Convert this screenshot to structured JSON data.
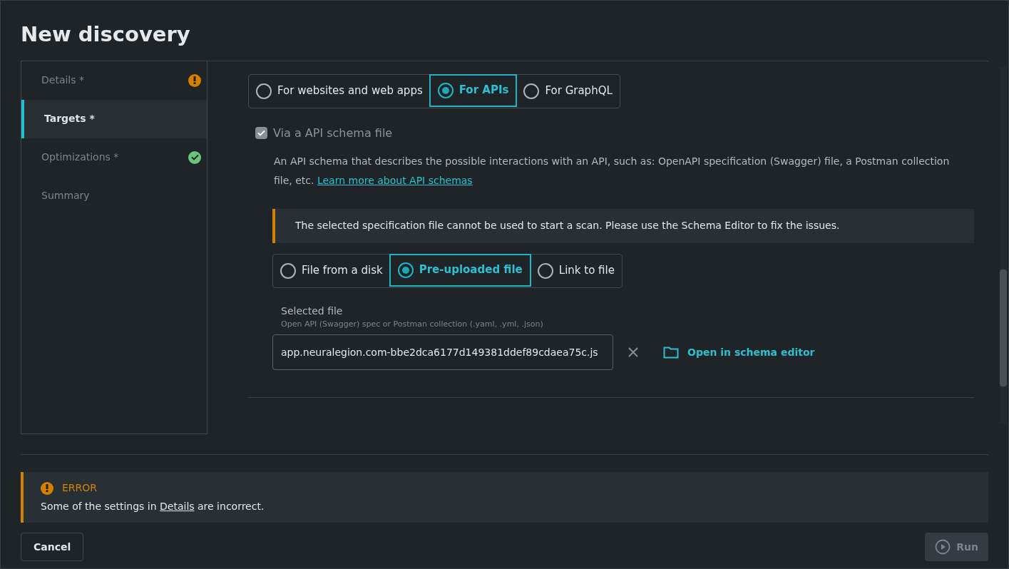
{
  "window": {
    "title": "New discovery"
  },
  "sidebar": {
    "items": [
      {
        "label": "Details *",
        "selected": false,
        "kind": "warning"
      },
      {
        "label": "Targets *",
        "selected": true,
        "kind": "plain"
      },
      {
        "label": "Optimizations *",
        "selected": false,
        "kind": "ok"
      },
      {
        "label": "Summary",
        "selected": false,
        "kind": "plain"
      }
    ]
  },
  "target_type": [
    {
      "label": "For websites and web apps",
      "selected": false
    },
    {
      "label": "For APIs",
      "selected": true
    },
    {
      "label": "For GraphQL",
      "selected": false
    }
  ],
  "schema_option": {
    "label": "Via a API schema file",
    "checked": true,
    "description": "An API schema that describes the possible interactions with an API, such as: OpenAPI specification (Swagger) file, a Postman collection file, etc.",
    "link": "Learn more about API schemas"
  },
  "warning": {
    "text": "The selected specification file cannot be used to start a scan. Please use the Schema Editor to fix the issues."
  },
  "file_source": [
    {
      "label": "File from a disk",
      "selected": false
    },
    {
      "label": "Pre-uploaded file",
      "selected": true
    },
    {
      "label": "Link to file",
      "selected": false
    }
  ],
  "selected_file": {
    "label": "Selected file",
    "hint": "Open API (Swagger) spec or Postman collection (.yaml, .yml, .json)",
    "value": "app.neuralegion.com-bbe2dca6177d149381ddef89cdaea75c.js",
    "action": "Open in schema editor"
  },
  "error": {
    "title": "ERROR",
    "text_before": "Some of the settings in",
    "link": "Details",
    "text_after": "are incorrect."
  },
  "buttons": {
    "cancel": "Cancel",
    "run": "Run",
    "run_disabled": true
  }
}
